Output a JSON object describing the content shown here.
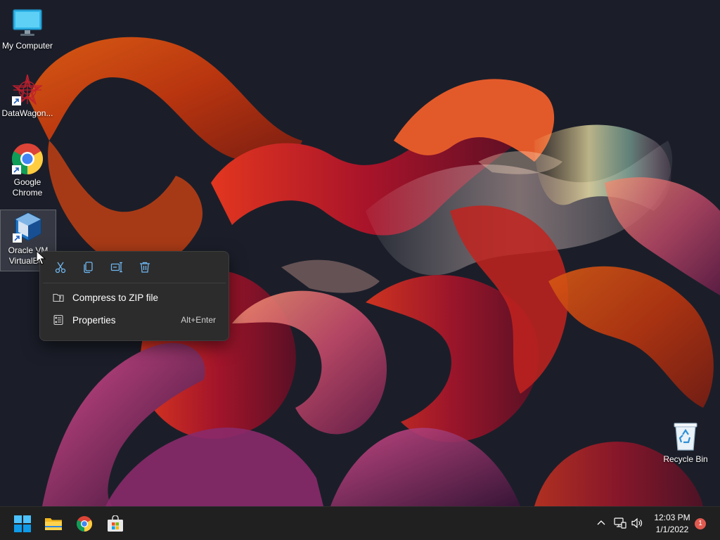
{
  "desktop": {
    "icons": [
      {
        "label": "My Computer",
        "icon": "monitor-icon",
        "shortcut": false
      },
      {
        "label": "DataWagon...",
        "icon": "datawagon-icon",
        "shortcut": true
      },
      {
        "label": "Google Chrome",
        "icon": "chrome-icon",
        "shortcut": true
      },
      {
        "label": "Oracle VM VirtualBox",
        "label_visible": "Oracle VM\nVirtualBox",
        "icon": "virtualbox-icon",
        "shortcut": true,
        "selected": true
      },
      {
        "label": "Recycle Bin",
        "icon": "recycle-bin-icon",
        "shortcut": false
      }
    ]
  },
  "context_menu": {
    "toolbar": [
      {
        "name": "cut",
        "icon": "scissors-icon"
      },
      {
        "name": "copy",
        "icon": "copy-icon"
      },
      {
        "name": "rename",
        "icon": "rename-icon"
      },
      {
        "name": "delete",
        "icon": "trash-icon"
      }
    ],
    "items": [
      {
        "label": "Compress to ZIP file",
        "icon": "zip-folder-icon",
        "accelerator": ""
      },
      {
        "label": "Properties",
        "icon": "properties-icon",
        "accelerator": "Alt+Enter"
      }
    ]
  },
  "taskbar": {
    "apps": [
      {
        "name": "start",
        "icon": "windows-logo-icon"
      },
      {
        "name": "file-explorer",
        "icon": "folder-icon"
      },
      {
        "name": "chrome",
        "icon": "chrome-icon"
      },
      {
        "name": "microsoft-store",
        "icon": "store-icon"
      }
    ],
    "tray": {
      "clock_time": "12:03 PM",
      "clock_date": "1/1/2022",
      "notification_count": "1"
    }
  },
  "colors": {
    "accent": "#0078d4",
    "taskbar_bg": "#202020",
    "menu_bg": "#2c2c2c",
    "badge": "#e05a4f"
  }
}
